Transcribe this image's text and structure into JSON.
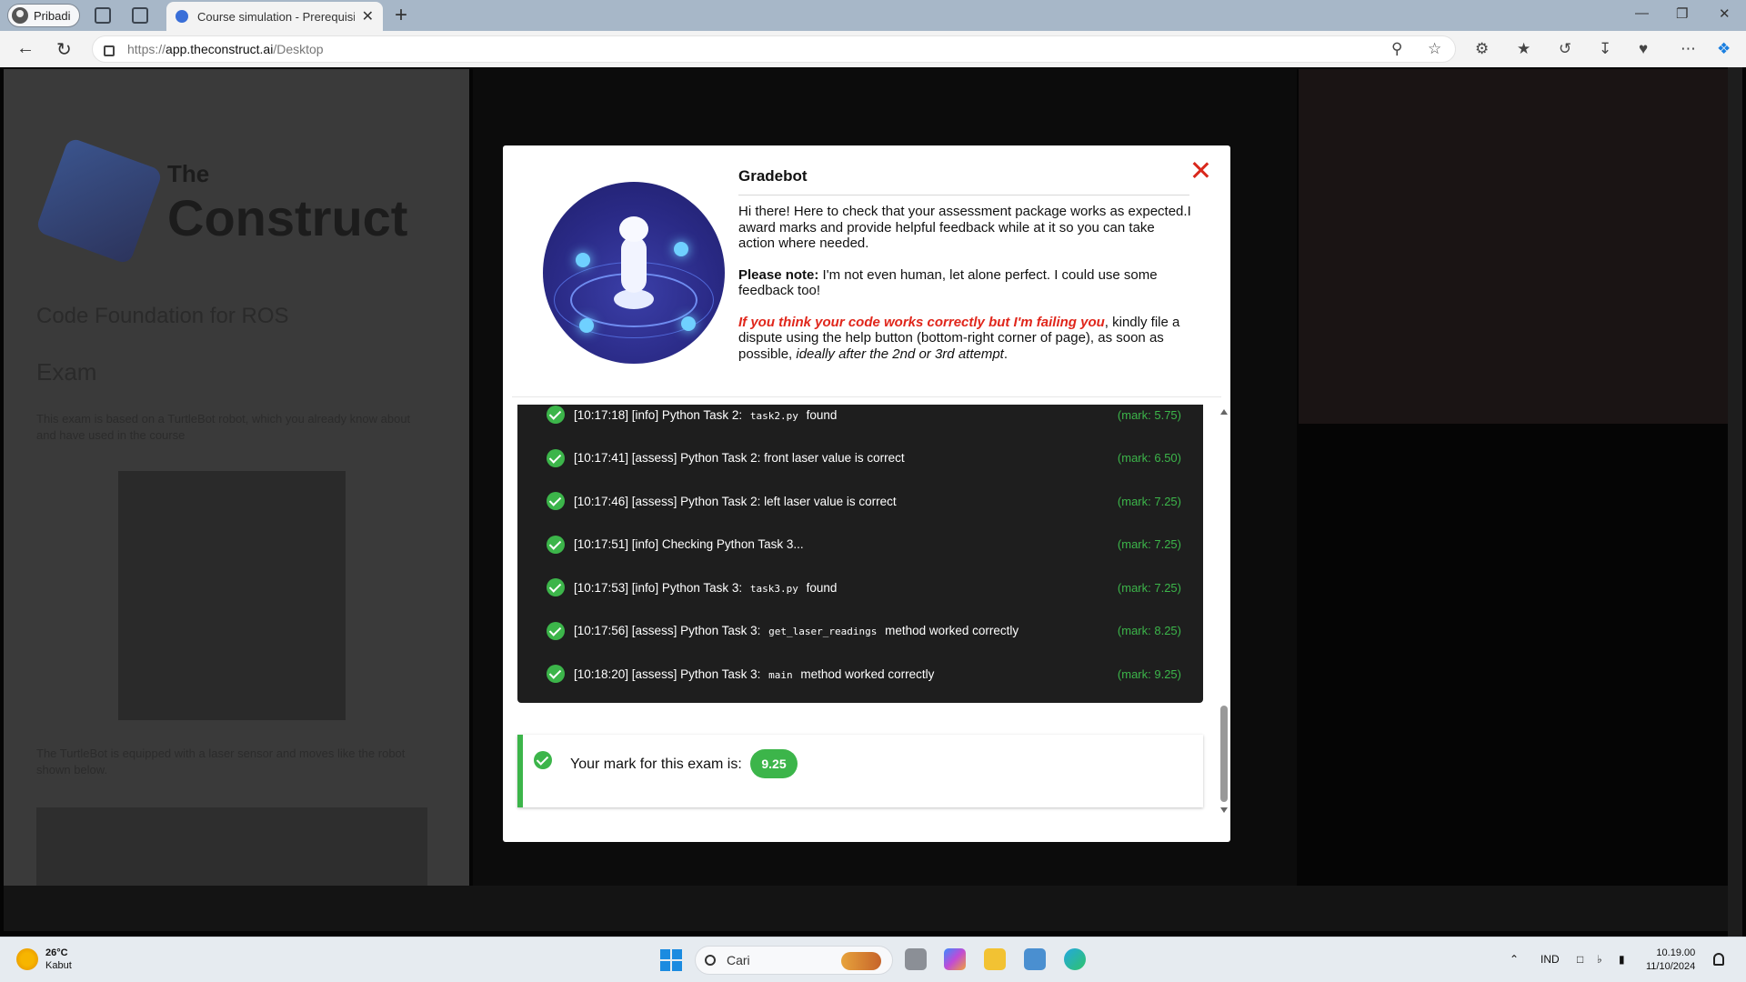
{
  "browser": {
    "profile_name": "Pribadi",
    "tab_title": "Course simulation - Prerequisites",
    "url_prefix": "https://",
    "url_domain": "app.theconstruct.ai",
    "url_path": "/Desktop",
    "new_tab": "+",
    "tab_close": "✕",
    "minimize": "—",
    "maximize": "❐",
    "close": "✕"
  },
  "modal": {
    "title": "Gradebot",
    "intro_1": "Hi there! Here to check that your assessment package works as expected.I award marks and provide helpful feedback while at it so you can take action where needed.",
    "note_label": "Please note:",
    "note_text": " I'm not even human, let alone perfect. I could use some feedback too!",
    "dispute_red": "If you think your code works correctly but I'm failing you",
    "dispute_text": ", kindly file a dispute using the help button (bottom-right corner of page), as soon as possible, ",
    "dispute_italic": "ideally after the 2nd or 3rd attempt",
    "dispute_end": ".",
    "log": [
      {
        "pre": "[10:17:18] [info] Python Task 2: ",
        "code": "task2.py",
        "post": " found",
        "mark": "(mark: 5.75)"
      },
      {
        "pre": "[10:17:41] [assess] Python Task 2: front laser value is correct",
        "code": "",
        "post": "",
        "mark": "(mark: 6.50)"
      },
      {
        "pre": "[10:17:46] [assess] Python Task 2: left laser value is correct",
        "code": "",
        "post": "",
        "mark": "(mark: 7.25)"
      },
      {
        "pre": "[10:17:51] [info] Checking Python Task 3...",
        "code": "",
        "post": "",
        "mark": "(mark: 7.25)"
      },
      {
        "pre": "[10:17:53] [info] Python Task 3: ",
        "code": "task3.py",
        "post": " found",
        "mark": "(mark: 7.25)"
      },
      {
        "pre": "[10:17:56] [assess] Python Task 3: ",
        "code": "get_laser_readings",
        "post": " method worked correctly",
        "mark": "(mark: 8.25)"
      },
      {
        "pre": "[10:18:20] [assess] Python Task 3: ",
        "code": "main",
        "post": " method worked correctly",
        "mark": "(mark: 9.25)"
      }
    ],
    "result_label": "Your mark for this exam is:",
    "result_score": "9.25"
  },
  "background": {
    "brand_small": "The",
    "brand": "Construct",
    "course_title": "Code Foundation for ROS",
    "section": "Exam",
    "text_1": "This exam is based on a TurtleBot robot, which you already know about and have used in the course",
    "text_2": "The TurtleBot is equipped with a laser sensor and moves like the robot shown below."
  },
  "taskbar": {
    "temperature": "26°C",
    "weather": "Kabut",
    "search_placeholder": "Cari",
    "language": "IND",
    "time": "10.19.00",
    "date": "11/10/2024"
  },
  "colors": {
    "accent_green": "#3cb54a",
    "close_red": "#d9281c",
    "log_bg": "#1e1e1e"
  }
}
